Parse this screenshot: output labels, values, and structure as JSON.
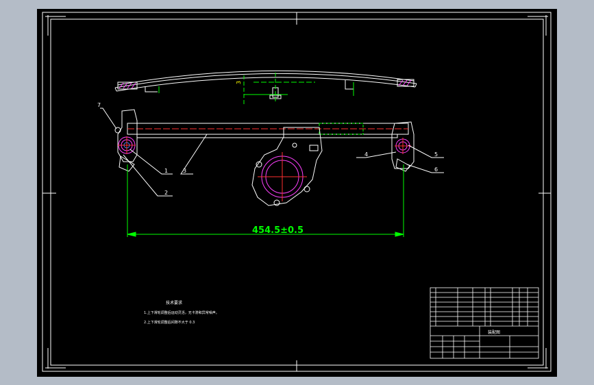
{
  "dimension": {
    "main_label": "454.5±0.5",
    "small_label": "3"
  },
  "balloons": {
    "b1": "1",
    "b2": "2",
    "b3": "3",
    "b4": "4",
    "b5": "5",
    "b6": "6",
    "b7": "7"
  },
  "notes": {
    "heading": "技术要求",
    "line1": "1.上下滑轮调整后运动灵活，无卡滞和异常噪声。",
    "line2": "2.上下滑轮调整后间隙不大于 0.3"
  },
  "title_block": {
    "assembly_title": "装配图"
  },
  "colors": {
    "sheet": "#000000",
    "background": "#b4bcc7",
    "outline": "#ffffff",
    "dimension": "#00ff00",
    "centerline": "#ff2020",
    "hatch": "#ff00ff",
    "hidden": "#00ff00"
  }
}
